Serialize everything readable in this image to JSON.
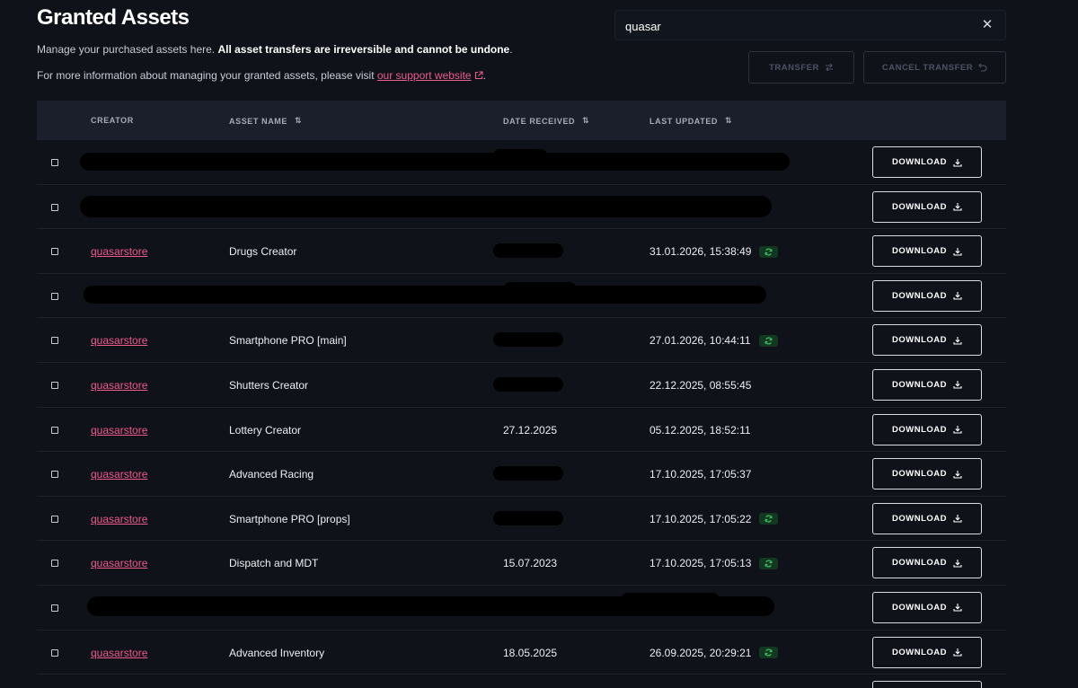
{
  "header": {
    "title": "Granted Assets",
    "intro_plain": "Manage your purchased assets here. ",
    "intro_bold": "All asset transfers are irreversible and cannot be undone",
    "intro_end": ".",
    "info_plain": "For more information about managing your granted assets, please visit ",
    "info_link": "our support website",
    "info_end": "."
  },
  "search": {
    "value": "quasar"
  },
  "actions": {
    "transfer_label": "TRANSFER",
    "cancel_label": "CANCEL TRANSFER"
  },
  "table": {
    "columns": {
      "creator": "CREATOR",
      "asset_name": "ASSET NAME",
      "date_received": "DATE RECEIVED",
      "last_updated": "LAST UPDATED"
    },
    "download_label": "DOWNLOAD",
    "rows": [
      {
        "creator": "",
        "asset": "",
        "date": "",
        "updated": "",
        "sync": false,
        "redacted": true
      },
      {
        "creator": "",
        "asset": "",
        "date": "",
        "updated": "",
        "sync": false,
        "redacted": true
      },
      {
        "creator": "quasarstore",
        "asset": "Drugs Creator",
        "date": "",
        "updated": "31.01.2026, 15:38:49",
        "sync": true,
        "redacted": false
      },
      {
        "creator": "",
        "asset": "",
        "date": "",
        "updated": "",
        "sync": false,
        "redacted": true
      },
      {
        "creator": "quasarstore",
        "asset": "Smartphone PRO [main]",
        "date": "",
        "updated": "27.01.2026, 10:44:11",
        "sync": true,
        "redacted": false
      },
      {
        "creator": "quasarstore",
        "asset": "Shutters Creator",
        "date": "",
        "updated": "22.12.2025, 08:55:45",
        "sync": false,
        "redacted": false
      },
      {
        "creator": "quasarstore",
        "asset": "Lottery Creator",
        "date": "27.12.2025",
        "updated": "05.12.2025, 18:52:11",
        "sync": false,
        "redacted": false
      },
      {
        "creator": "quasarstore",
        "asset": "Advanced Racing",
        "date": "",
        "updated": "17.10.2025, 17:05:37",
        "sync": false,
        "redacted": false
      },
      {
        "creator": "quasarstore",
        "asset": "Smartphone PRO [props]",
        "date": "",
        "updated": "17.10.2025, 17:05:22",
        "sync": true,
        "redacted": false
      },
      {
        "creator": "quasarstore",
        "asset": "Dispatch and MDT",
        "date": "15.07.2023",
        "updated": "17.10.2025, 17:05:13",
        "sync": true,
        "redacted": false
      },
      {
        "creator": "",
        "asset": "",
        "date": "",
        "updated": "",
        "sync": false,
        "redacted": true
      },
      {
        "creator": "quasarstore",
        "asset": "Advanced Inventory",
        "date": "18.05.2025",
        "updated": "26.09.2025, 20:29:21",
        "sync": true,
        "redacted": false
      }
    ]
  },
  "colors": {
    "accent_pink": "#ee5b8d",
    "sync_badge": "#12391f",
    "sync_icon": "#3fc36b",
    "background": "#0f1219"
  },
  "icons": {
    "external_link": "external-link-icon",
    "clear": "close-icon",
    "transfer": "swap-icon",
    "cancel": "undo-icon",
    "sort": "sort-icon",
    "download": "download-icon",
    "sync": "sync-icon"
  }
}
